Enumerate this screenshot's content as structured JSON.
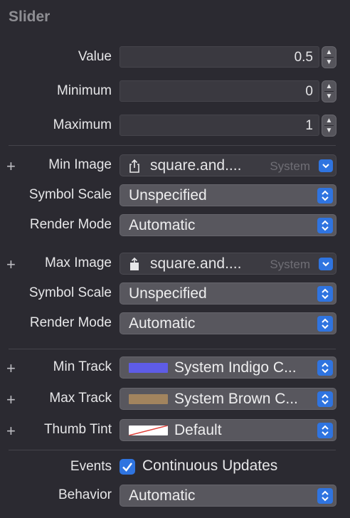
{
  "section_title": "Slider",
  "value": {
    "label": "Value",
    "value": "0.5"
  },
  "minimum": {
    "label": "Minimum",
    "value": "0"
  },
  "maximum": {
    "label": "Maximum",
    "value": "1"
  },
  "min_image": {
    "label": "Min Image",
    "value": "square.and....",
    "hint": "System"
  },
  "min_symbol_scale": {
    "label": "Symbol Scale",
    "value": "Unspecified"
  },
  "min_render_mode": {
    "label": "Render Mode",
    "value": "Automatic"
  },
  "max_image": {
    "label": "Max Image",
    "value": "square.and....",
    "hint": "System"
  },
  "max_symbol_scale": {
    "label": "Symbol Scale",
    "value": "Unspecified"
  },
  "max_render_mode": {
    "label": "Render Mode",
    "value": "Automatic"
  },
  "min_track": {
    "label": "Min Track",
    "value": "System Indigo C...",
    "color": "#5e5ce6"
  },
  "max_track": {
    "label": "Max Track",
    "value": "System Brown C...",
    "color": "#a2845e"
  },
  "thumb_tint": {
    "label": "Thumb Tint",
    "value": "Default"
  },
  "events": {
    "label": "Events",
    "option": "Continuous Updates",
    "checked": true
  },
  "behavior": {
    "label": "Behavior",
    "value": "Automatic"
  },
  "colors": {
    "accent": "#2f74e0",
    "background": "#2b2a31"
  }
}
